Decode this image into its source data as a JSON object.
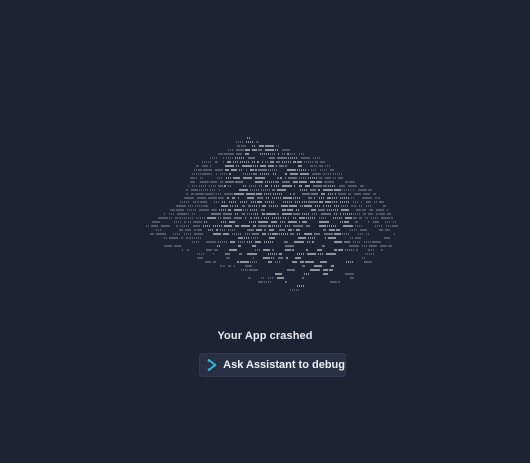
{
  "crash": {
    "title": "Your App crashed"
  },
  "action": {
    "debug_label": "Ask Assistant to debug",
    "icon": "assistant-sparkle-icon"
  },
  "colors": {
    "background": "#1e2333",
    "ascii_light": "#c9ccd4",
    "ascii_dim": "#8d93a3",
    "button_bg": "#283043",
    "icon_accent": "#35b6d6"
  }
}
